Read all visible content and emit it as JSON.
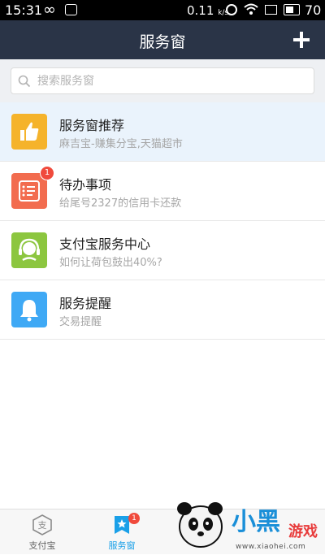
{
  "status_bar": {
    "time": "15:31",
    "network_speed": "0.11",
    "network_unit": "k/s",
    "battery": "70",
    "battery_level_percent": 70
  },
  "nav": {
    "title": "服务窗"
  },
  "search": {
    "placeholder": "搜索服务窗"
  },
  "list": [
    {
      "title": "服务窗推荐",
      "subtitle": "麻吉宝-赚集分宝,天猫超市",
      "icon": "thumbs-up-icon",
      "color": "#f5b32b",
      "badge": ""
    },
    {
      "title": "待办事项",
      "subtitle": "给尾号2327的信用卡还款",
      "icon": "todo-list-icon",
      "color": "#f26c4f",
      "badge": "1"
    },
    {
      "title": "支付宝服务中心",
      "subtitle": "如何让荷包鼓出40%?",
      "icon": "headset-icon",
      "color": "#8cc63f",
      "badge": ""
    },
    {
      "title": "服务提醒",
      "subtitle": "交易提醒",
      "icon": "bell-icon",
      "color": "#3fa9f5",
      "badge": ""
    }
  ],
  "tabs": [
    {
      "label": "支付宝",
      "icon": "alipay-icon",
      "active": false
    },
    {
      "label": "服务窗",
      "icon": "star-bookmark-icon",
      "active": true,
      "badge": "1"
    }
  ],
  "watermark": {
    "text": "小黑游戏",
    "url": "www.xiaohei.com"
  },
  "colors": {
    "nav_bg": "#2a3447",
    "accent": "#1aa0e8",
    "badge": "#f04a3c",
    "highlight_row": "#eaf3fc"
  }
}
